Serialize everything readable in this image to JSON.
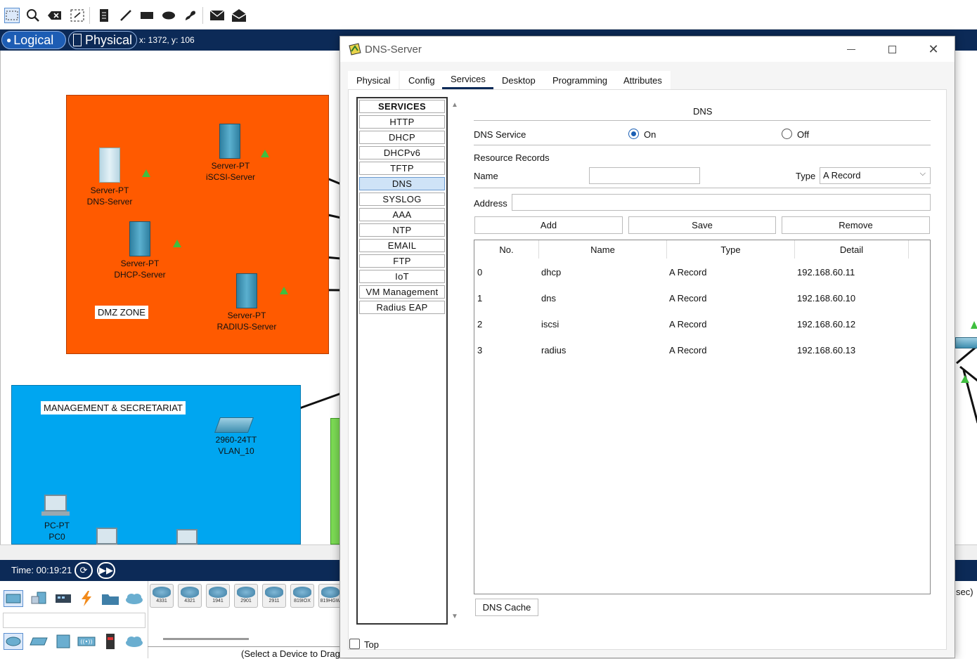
{
  "workspace": {
    "modes": {
      "logical": "Logical",
      "physical": "Physical"
    },
    "coords": "x: 1372, y: 106",
    "zones": {
      "dmz": "DMZ ZONE",
      "mgmt": "MANAGEMENT & SECRETARIAT"
    },
    "devices": {
      "dns_type": "Server-PT",
      "dns_name": "DNS-Server",
      "iscsi_type": "Server-PT",
      "iscsi_name": "iSCSI-Server",
      "dhcp_type": "Server-PT",
      "dhcp_name": "DHCP-Server",
      "radius_type": "Server-PT",
      "radius_name": "RADIUS-Server",
      "switch_type": "2960-24TT",
      "switch_name": "VLAN_10",
      "pc_type": "PC-PT",
      "pc_name": "PC0"
    }
  },
  "bottom": {
    "time": "Time: 00:19:21",
    "routers": [
      "4331",
      "4321",
      "1941",
      "2901",
      "2911",
      "819IOX",
      "819HGW"
    ],
    "hint": "(Select a Device to Drag",
    "right_fragment": "sec)"
  },
  "window": {
    "title": "DNS-Server",
    "tabs": [
      "Physical",
      "Config",
      "Services",
      "Desktop",
      "Programming",
      "Attributes"
    ],
    "active_tab": "Services",
    "services": [
      "SERVICES",
      "HTTP",
      "DHCP",
      "DHCPv6",
      "TFTP",
      "DNS",
      "SYSLOG",
      "AAA",
      "NTP",
      "EMAIL",
      "FTP",
      "IoT",
      "VM Management",
      "Radius EAP"
    ],
    "selected_service": "DNS",
    "dns": {
      "heading": "DNS",
      "service_label": "DNS Service",
      "on_label": "On",
      "off_label": "Off",
      "service_state": "On",
      "resource_records_label": "Resource Records",
      "name_label": "Name",
      "name_value": "",
      "type_label": "Type",
      "type_value": "A Record",
      "address_label": "Address",
      "address_value": "",
      "add_button": "Add",
      "save_button": "Save",
      "remove_button": "Remove",
      "columns": [
        "No.",
        "Name",
        "Type",
        "Detail"
      ],
      "records": [
        {
          "no": "0",
          "name": "dhcp",
          "type": "A Record",
          "detail": "192.168.60.11"
        },
        {
          "no": "1",
          "name": "dns",
          "type": "A Record",
          "detail": "192.168.60.10"
        },
        {
          "no": "2",
          "name": "iscsi",
          "type": "A Record",
          "detail": "192.168.60.12"
        },
        {
          "no": "3",
          "name": "radius",
          "type": "A Record",
          "detail": "192.168.60.13"
        }
      ],
      "cache_button": "DNS Cache"
    },
    "top_label": "Top"
  }
}
